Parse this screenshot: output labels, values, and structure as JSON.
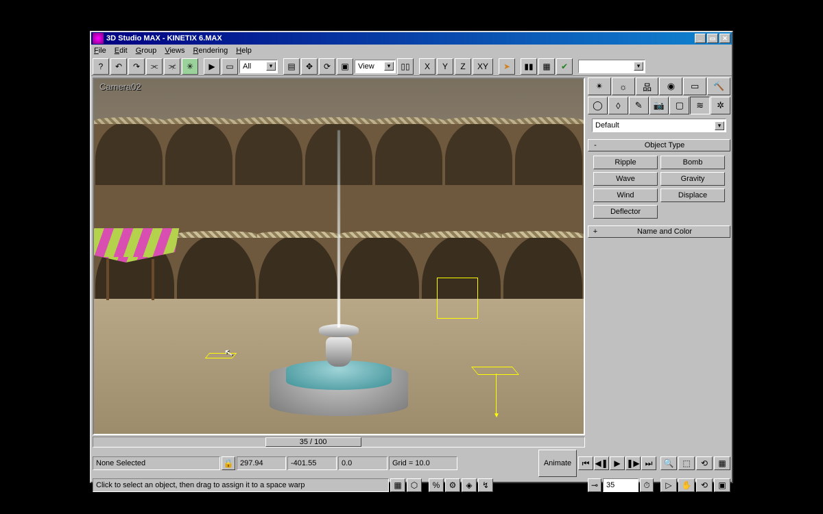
{
  "window": {
    "title": "3D Studio MAX - KINETIX 6.MAX"
  },
  "menu": [
    "File",
    "Edit",
    "Group",
    "Views",
    "Rendering",
    "Help"
  ],
  "toolbar": {
    "filter_combo": "All",
    "ref_combo": "View",
    "axis": [
      "X",
      "Y",
      "Z",
      "XY"
    ]
  },
  "viewport": {
    "label": "Camera02"
  },
  "timeslider": {
    "label": "35 / 100"
  },
  "right": {
    "tabs1": [
      "hand",
      "teapot",
      "hier",
      "motion",
      "disp",
      "util",
      "hammer"
    ],
    "tabs2": [
      "geom",
      "shape",
      "light",
      "cam",
      "helper",
      "warp",
      "sys"
    ],
    "category": "Default",
    "rollout1": {
      "sign": "-",
      "label": "Object Type"
    },
    "objects": [
      "Ripple",
      "Bomb",
      "Wave",
      "Gravity",
      "Wind",
      "Displace",
      "Deflector"
    ],
    "rollout2": {
      "sign": "+",
      "label": "Name and Color"
    }
  },
  "status": {
    "selection": "None Selected",
    "x": "297.94",
    "y": "-401.55",
    "z": "0.0",
    "grid": "Grid = 10.0",
    "animate": "Animate",
    "frame": "35",
    "hint": "Click to select an object, then drag to assign it to a space warp"
  }
}
